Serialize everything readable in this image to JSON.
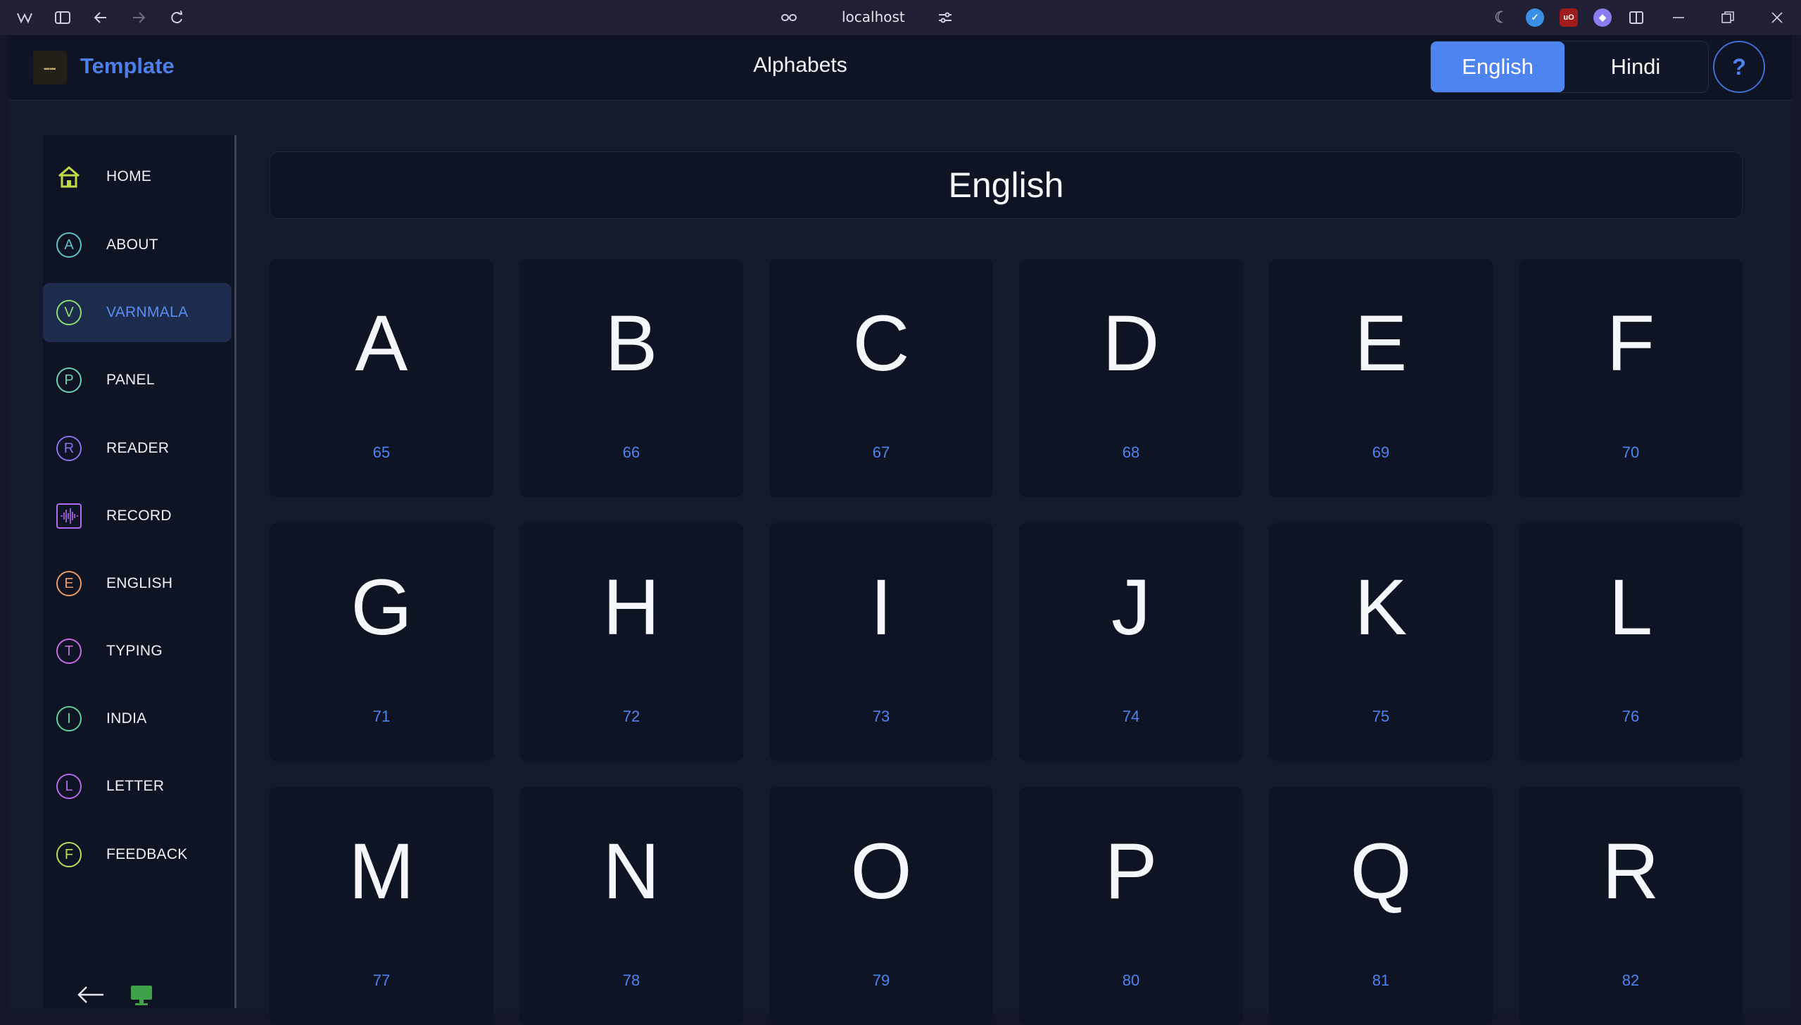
{
  "browser": {
    "url": "localhost"
  },
  "app": {
    "brand": "Template",
    "page_title": "Alphabets",
    "languages": [
      "English",
      "Hindi"
    ],
    "active_language": "English",
    "help_label": "?"
  },
  "sidebar": {
    "items": [
      {
        "label": "HOME",
        "icon": "home-icon",
        "color": "#c2d94a"
      },
      {
        "label": "ABOUT",
        "badge": "A",
        "color": "#5fc3c9"
      },
      {
        "label": "VARNMALA",
        "badge": "V",
        "color": "#8fdc74"
      },
      {
        "label": "PANEL",
        "badge": "P",
        "color": "#6fd1b3"
      },
      {
        "label": "READER",
        "badge": "R",
        "color": "#8a6ff0"
      },
      {
        "label": "RECORD",
        "icon": "waveform-icon",
        "color": "#b06cf2"
      },
      {
        "label": "ENGLISH",
        "badge": "E",
        "color": "#ef9a62"
      },
      {
        "label": "TYPING",
        "badge": "T",
        "color": "#c46be0"
      },
      {
        "label": "INDIA",
        "badge": "I",
        "color": "#5fd29a"
      },
      {
        "label": "LETTER",
        "badge": "L",
        "color": "#b36be8"
      },
      {
        "label": "FEEDBACK",
        "badge": "F",
        "color": "#b9df5a"
      }
    ],
    "active": "VARNMALA"
  },
  "main": {
    "section_title": "English",
    "letters": [
      {
        "letter": "A",
        "code": "65"
      },
      {
        "letter": "B",
        "code": "66"
      },
      {
        "letter": "C",
        "code": "67"
      },
      {
        "letter": "D",
        "code": "68"
      },
      {
        "letter": "E",
        "code": "69"
      },
      {
        "letter": "F",
        "code": "70"
      },
      {
        "letter": "G",
        "code": "71"
      },
      {
        "letter": "H",
        "code": "72"
      },
      {
        "letter": "I",
        "code": "73"
      },
      {
        "letter": "J",
        "code": "74"
      },
      {
        "letter": "K",
        "code": "75"
      },
      {
        "letter": "L",
        "code": "76"
      },
      {
        "letter": "M",
        "code": "77"
      },
      {
        "letter": "N",
        "code": "78"
      },
      {
        "letter": "O",
        "code": "79"
      },
      {
        "letter": "P",
        "code": "80"
      },
      {
        "letter": "Q",
        "code": "81"
      },
      {
        "letter": "R",
        "code": "82"
      }
    ]
  },
  "colors": {
    "accent": "#4d84ef",
    "background": "#141a2c",
    "card": "#0f1424"
  }
}
